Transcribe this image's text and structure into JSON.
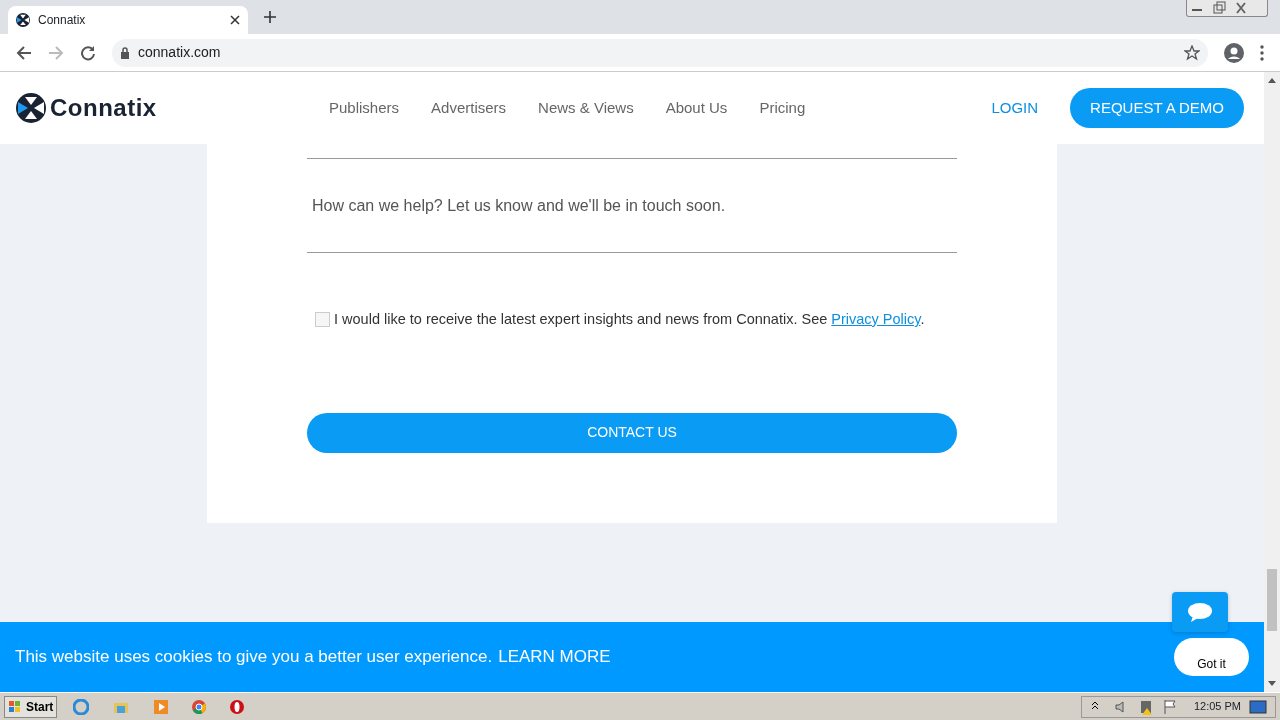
{
  "browser": {
    "tab": {
      "title": "Connatix",
      "selected": true
    },
    "address": "connatix.com"
  },
  "nav": {
    "brand": "Connatix",
    "links": [
      "Publishers",
      "Advertisers",
      "News & Views",
      "About Us",
      "Pricing"
    ],
    "login": "LOGIN",
    "cta": "REQUEST A DEMO"
  },
  "form": {
    "message_placeholder": "How can we help? Let us know and we'll be in touch soon.",
    "consent": {
      "checked": false,
      "text": "I would like to receive the latest expert insights and news from Connatix. See ",
      "link": "Privacy Policy",
      "after": "."
    },
    "submit": "CONTACT US"
  },
  "cookie_bar": {
    "text": "This website uses cookies to give you a better user experience.",
    "link": "LEARN MORE",
    "button": "Got it"
  },
  "taskbar": {
    "start": "Start",
    "clock": "12:05 PM"
  }
}
